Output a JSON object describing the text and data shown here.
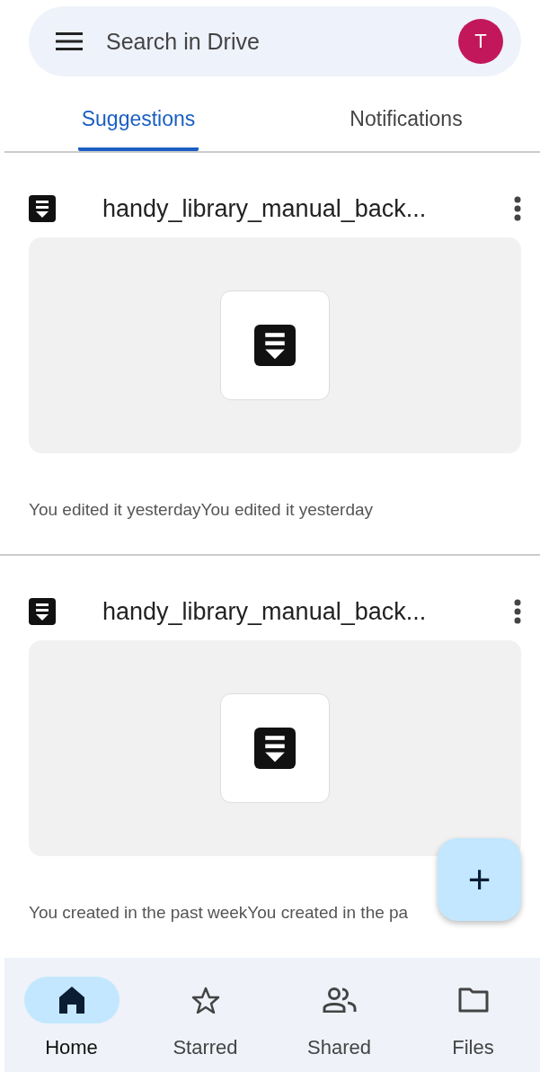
{
  "search": {
    "placeholder": "Search in Drive",
    "avatar": "T"
  },
  "tabs": [
    {
      "label": "Suggestions",
      "selected": true
    },
    {
      "label": "Notifications",
      "selected": false
    }
  ],
  "files": [
    {
      "name": "handy_library_manual_back...",
      "caption": "You edited it yesterdayYou edited it yesterday"
    },
    {
      "name": "handy_library_manual_back...",
      "caption": "You created in the past weekYou created in the pa"
    }
  ],
  "fab": {
    "label": "+"
  },
  "nav": [
    {
      "label": "Home",
      "kind": "home",
      "selected": true
    },
    {
      "label": "Starred",
      "kind": "star",
      "selected": false
    },
    {
      "label": "Shared",
      "kind": "people",
      "selected": false
    },
    {
      "label": "Files",
      "kind": "folder",
      "selected": false
    }
  ]
}
